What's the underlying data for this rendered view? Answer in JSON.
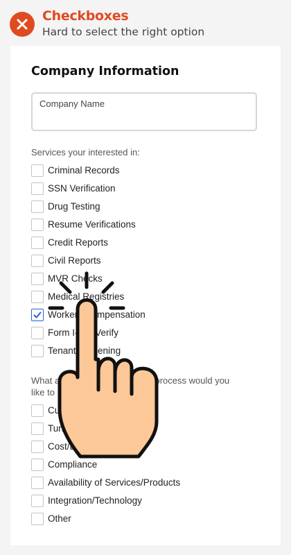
{
  "header": {
    "title": "Checkboxes",
    "subtitle": "Hard to select the right option",
    "icon": "close-x-icon",
    "accent_color": "#e04a1f"
  },
  "form": {
    "title": "Company Information",
    "company_name_label": "Company Name",
    "services_label": "Services your interested in:",
    "services": [
      {
        "label": "Criminal Records",
        "checked": false
      },
      {
        "label": "SSN Verification",
        "checked": false
      },
      {
        "label": "Drug Testing",
        "checked": false
      },
      {
        "label": "Resume Verifications",
        "checked": false
      },
      {
        "label": "Credit Reports",
        "checked": false
      },
      {
        "label": "Civil Reports",
        "checked": false
      },
      {
        "label": "MVR Checks",
        "checked": false
      },
      {
        "label": "Medical Registries",
        "checked": false
      },
      {
        "label": "Workers Compensation",
        "checked": true
      },
      {
        "label": "Form I-9 E-Verify",
        "checked": false
      },
      {
        "label": "Tenant Screening",
        "checked": false
      }
    ],
    "aspects_label_line1": "What aspects of the screening process would you",
    "aspects_label_line2": "like to improve?",
    "aspects": [
      {
        "label": "Customer Service",
        "checked": false
      },
      {
        "label": "Turnaround Time",
        "checked": false
      },
      {
        "label": "Cost/Budget",
        "checked": false
      },
      {
        "label": "Compliance",
        "checked": false
      },
      {
        "label": "Availability of Services/Products",
        "checked": false
      },
      {
        "label": "Integration/Technology",
        "checked": false
      },
      {
        "label": "Other",
        "checked": false
      }
    ],
    "checkbox_accent": "#1e63d6"
  },
  "overlay": {
    "icon": "pointing-hand-icon",
    "skin_color": "#fcc898"
  }
}
